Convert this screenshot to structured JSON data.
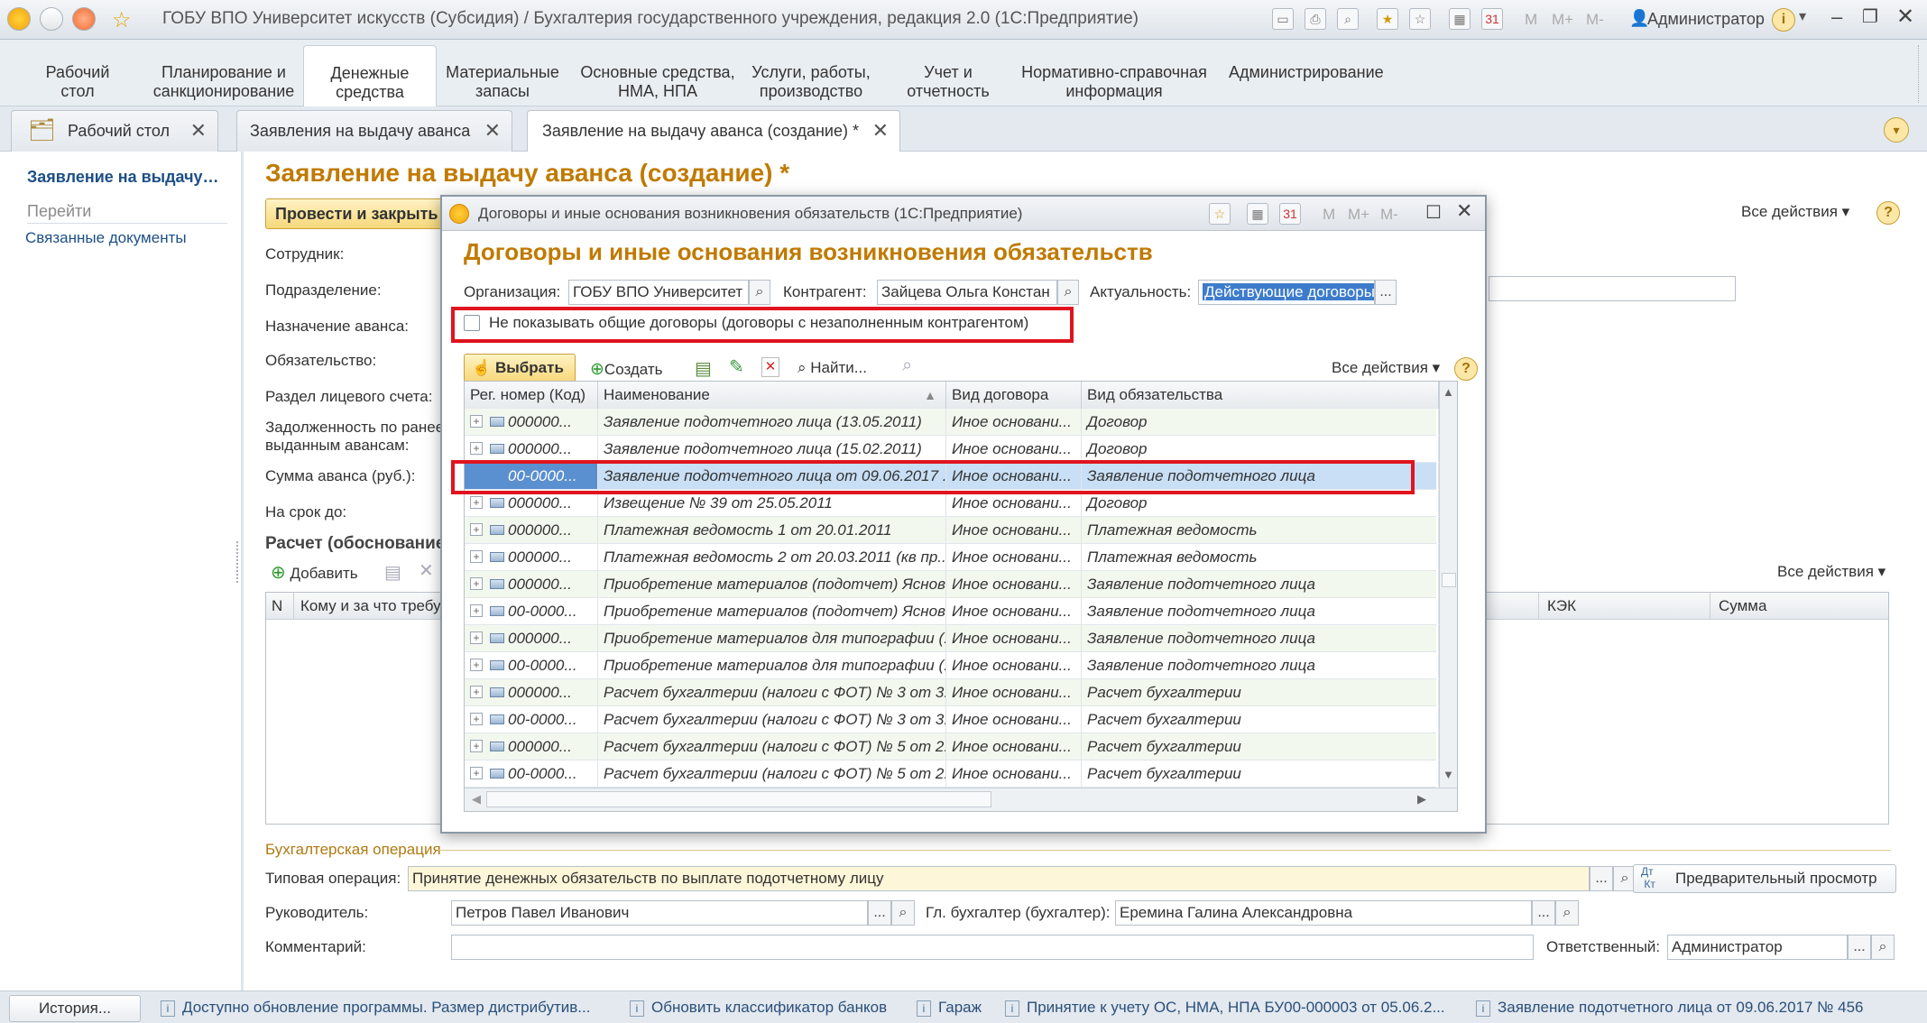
{
  "window": {
    "title": "ГОБУ ВПО Университет искусств (Субсидия) / Бухгалтерия государственного учреждения, редакция 2.0  (1С:Предприятие)",
    "user": "Администратор",
    "memory_buttons": [
      "M",
      "M+",
      "M-"
    ]
  },
  "sections": [
    {
      "label1": "Рабочий",
      "label2": "стол"
    },
    {
      "label1": "Планирование и",
      "label2": "санкционирование"
    },
    {
      "label1": "Денежные",
      "label2": "средства"
    },
    {
      "label1": "Материальные",
      "label2": "запасы"
    },
    {
      "label1": "Основные средства,",
      "label2": "НМА, НПА"
    },
    {
      "label1": "Услуги, работы,",
      "label2": "производство"
    },
    {
      "label1": "Учет и",
      "label2": "отчетность"
    },
    {
      "label1": "Нормативно-справочная",
      "label2": "информация"
    },
    {
      "label1": "Администрирование",
      "label2": ""
    }
  ],
  "tabs": [
    {
      "label": "Рабочий стол"
    },
    {
      "label": "Заявления на выдачу аванса"
    },
    {
      "label": "Заявление на выдачу аванса (создание) *"
    }
  ],
  "leftpanel": {
    "title": "Заявление на выдачу…",
    "goto": "Перейти",
    "link": "Связанные документы"
  },
  "form": {
    "title": "Заявление на выдачу аванса (создание) *",
    "post_close": "Провести и закрыть",
    "all_actions": "Все действия",
    "labels": {
      "employee": "Сотрудник:",
      "department": "Подразделение:",
      "purpose": "Назначение аванса:",
      "obligation": "Обязательство:",
      "account_section": "Раздел лицевого счета:",
      "debt1": "Задолженность по ранее",
      "debt2": "выданным авансам:",
      "amount": "Сумма аванса (руб.):",
      "due": "На срок до:"
    },
    "calc_title": "Расчет (обоснование",
    "add": "Добавить",
    "table_headers": {
      "n": "N",
      "to_whom": "Кому и за что требу",
      "kek": "КЭК",
      "sum": "Сумма"
    },
    "accounting_op": "Бухгалтерская операция",
    "typical_op_label": "Типовая операция:",
    "typical_op_value": "Принятие денежных обязательств по выплате подотчетному лицу",
    "preview": "Предварительный просмотр",
    "manager_label": "Руководитель:",
    "manager_value": "Петров Павел Иванович",
    "chief_label": "Гл. бухгалтер (бухгалтер):",
    "chief_value": "Еремина Галина Александровна",
    "comment_label": "Комментарий:",
    "responsible_label": "Ответственный:",
    "responsible_value": "Администратор"
  },
  "dialog": {
    "window_title": "Договоры и иные основания возникновения обязательств  (1С:Предприятие)",
    "title": "Договоры и иные основания возникновения обязательств",
    "org_label": "Организация:",
    "org_value": "ГОБУ ВПО Университет",
    "contractor_label": "Контрагент:",
    "contractor_value": "Зайцева Ольга Констан",
    "actual_label": "Актуальность:",
    "actual_value": "Действующие договоры",
    "checkbox_label": "Не показывать общие договоры (договоры с незаполненным контрагентом)",
    "select": "Выбрать",
    "create": "Создать",
    "find": "Найти...",
    "all_actions": "Все действия",
    "columns": [
      "Рег. номер (Код)",
      "Наименование",
      "Вид договора",
      "Вид обязательства"
    ],
    "rows": [
      {
        "code": "000000...",
        "name": "Заявление подотчетного лица (13.05.2011)",
        "type": "Иное основани...",
        "obligation": "Договор"
      },
      {
        "code": "000000...",
        "name": "Заявление подотчетного лица (15.02.2011)",
        "type": "Иное основани...",
        "obligation": "Договор"
      },
      {
        "code": "00-0000...",
        "name": "Заявление подотчетного лица от 09.06.2017 ...",
        "type": "Иное основани...",
        "obligation": "Заявление подотчетного лица"
      },
      {
        "code": "000000...",
        "name": "Извещение № 39 от 25.05.2011",
        "type": "Иное основани...",
        "obligation": "Договор"
      },
      {
        "code": "000000...",
        "name": "Платежная ведомость  1 от 20.01.2011",
        "type": "Иное основани...",
        "obligation": "Платежная ведомость"
      },
      {
        "code": "000000...",
        "name": "Платежная ведомость  2 от 20.03.2011 (кв пр...",
        "type": "Иное основани...",
        "obligation": "Платежная ведомость"
      },
      {
        "code": "000000...",
        "name": "Приобретение материалов (подотчет) Яснов",
        "type": "Иное основани...",
        "obligation": "Заявление подотчетного лица"
      },
      {
        "code": "00-0000...",
        "name": "Приобретение материалов (подотчет) Яснов...",
        "type": "Иное основани...",
        "obligation": "Заявление подотчетного лица"
      },
      {
        "code": "000000...",
        "name": "Приобретение материалов для типографии (...",
        "type": "Иное основани...",
        "obligation": "Заявление подотчетного лица"
      },
      {
        "code": "00-0000...",
        "name": "Приобретение материалов для типографии (...",
        "type": "Иное основани...",
        "obligation": "Заявление подотчетного лица"
      },
      {
        "code": "000000...",
        "name": "Расчет бухгалтерии (налоги с ФОТ) № 3 от 3...",
        "type": "Иное основани...",
        "obligation": "Расчет бухгалтерии"
      },
      {
        "code": "00-0000...",
        "name": "Расчет бухгалтерии (налоги с ФОТ) № 3 от 3...",
        "type": "Иное основани...",
        "obligation": "Расчет бухгалтерии"
      },
      {
        "code": "000000...",
        "name": "Расчет бухгалтерии (налоги с ФОТ) № 5 от 2...",
        "type": "Иное основани...",
        "obligation": "Расчет бухгалтерии"
      },
      {
        "code": "00-0000...",
        "name": "Расчет бухгалтерии (налоги с ФОТ) № 5 от 2...",
        "type": "Иное основани...",
        "obligation": "Расчет бухгалтерии"
      }
    ]
  },
  "statusbar": {
    "history": "История...",
    "items": [
      "Доступно обновление программы. Размер дистрибутив...",
      "Обновить классификатор банков",
      "Гараж",
      "Принятие к учету ОС, НМА, НПА БУ00-000003 от 05.06.2...",
      "Заявление подотчетного лица от 09.06.2017 № 456"
    ]
  }
}
